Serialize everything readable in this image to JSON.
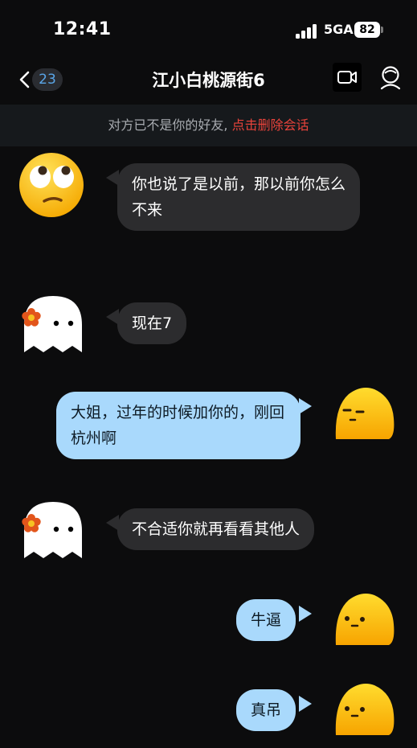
{
  "status_bar": {
    "time": "12:41",
    "network": "5GA",
    "battery": "82"
  },
  "nav": {
    "unread_count": "23",
    "title": "江小白桃源街6"
  },
  "notice": {
    "text": "对方已不是你的好友, ",
    "link": "点击删除会话"
  },
  "messages": [
    {
      "from": "them",
      "avatar": "eye-roll-emoji-icon",
      "text": "你也说了是以前，那以前你怎么不来"
    },
    {
      "from": "them",
      "avatar": "ghost-flower-icon",
      "text": "现在7"
    },
    {
      "from": "me",
      "avatar": "yellow-blob-icon",
      "text": "大姐，过年的时候加你的，刚回杭州啊"
    },
    {
      "from": "them",
      "avatar": "ghost-flower-icon",
      "text": "不合适你就再看看其他人"
    },
    {
      "from": "me",
      "avatar": "yellow-blob-icon",
      "text": "牛逼"
    },
    {
      "from": "me",
      "avatar": "yellow-blob-icon",
      "text": "真吊"
    }
  ],
  "colors": {
    "background": "#0c0c0d",
    "incoming_bubble": "#2c2c2e",
    "outgoing_bubble": "#a9d9fc",
    "notice_link": "#e8433b",
    "unread_badge_text": "#5aa6e8"
  }
}
